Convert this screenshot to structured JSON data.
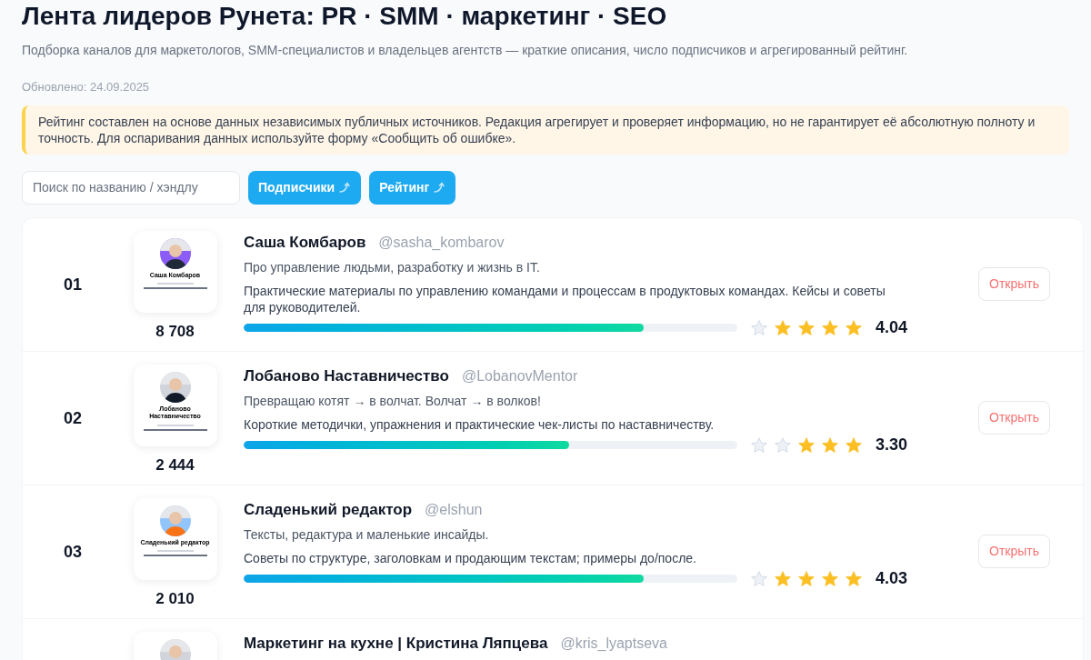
{
  "title": "Лента лидеров Рунета: PR · SMM · маркетинг · SEO",
  "subtitle": "Подборка каналов для маркетологов, SMM-специалистов и владельцев агентств — краткие описания, число подписчиков и агрегированный рейтинг.",
  "updated": "Обновлено: 24.09.2025",
  "notice": "Рейтинг составлен на основе данных независимых публичных источников. Редакция агрегирует и проверяет информацию, но не гарантирует её абсолютную полноту и точность. Для оспаривания данных используйте форму «Сообщить об ошибке».",
  "search": {
    "placeholder": "Поиск по названию / хэндлу"
  },
  "sort_buttons": [
    "Подписчики",
    "Рейтинг"
  ],
  "channels": [
    {
      "rank": "01",
      "thumbnail_title": "Саша Комбаров",
      "subscribers": "8 708",
      "name": "Саша Комбаров",
      "handle": "@sasha_kombarov",
      "tagline": "Про управление людьми, разработку и жизнь в IT.",
      "description": "Практические материалы по управлению командами и процессам в продуктовых командах. Кейсы и советы для руководителей.",
      "level": 0.81,
      "stars": 4,
      "score": "4.04",
      "action": "Открыть"
    },
    {
      "rank": "02",
      "thumbnail_title": "Лобаново Наставничество",
      "subscribers": "2 444",
      "name": "Лобаново Наставничество",
      "handle": "@LobanovMentor",
      "tagline": "Превращаю котят → в волчат. Волчат → в волков!",
      "description": "Короткие методички, упражнения и практические чек-листы по наставничеству.",
      "level": 0.66,
      "stars": 3,
      "score": "3.30",
      "action": "Открыть"
    },
    {
      "rank": "03",
      "thumbnail_title": "Сладенький редактор",
      "subscribers": "2 010",
      "name": "Сладенький редактор",
      "handle": "@elshun",
      "tagline": "Тексты, редактура и маленькие инсайды.",
      "description": "Советы по структуре, заголовкам и продающим текстам; примеры до/после.",
      "level": 0.81,
      "stars": 4,
      "score": "4.03",
      "action": "Открыть"
    },
    {
      "name": "Маркетинг на кухне | Кристина Ляпцева",
      "handle": "@kris_lyaptseva"
    }
  ]
}
